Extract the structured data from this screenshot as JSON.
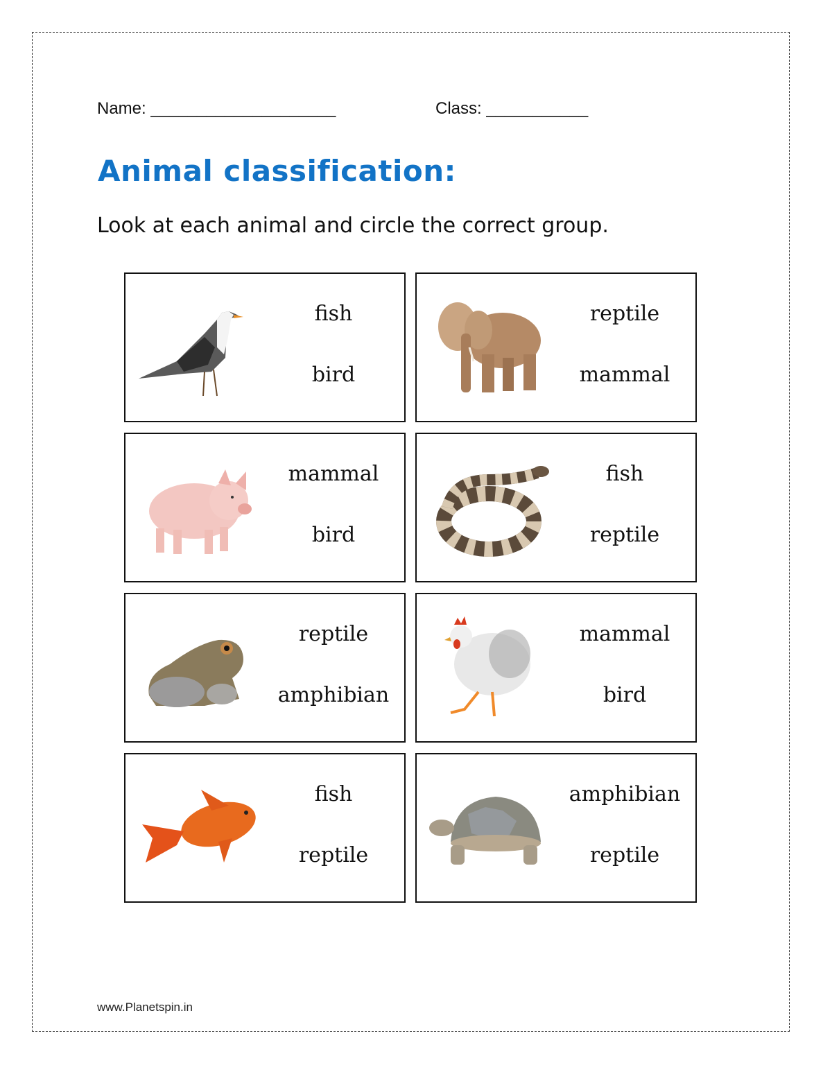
{
  "header": {
    "name_label": "Name: ____________________",
    "class_label": "Class: ___________"
  },
  "title": "Animal classification:",
  "instruction": "Look at each animal and circle the correct group.",
  "title_color": "#1273c6",
  "cards": [
    {
      "animal": "seagull",
      "options": [
        "fish",
        "bird"
      ]
    },
    {
      "animal": "elephant",
      "options": [
        "reptile",
        "mammal"
      ]
    },
    {
      "animal": "pig",
      "options": [
        "mammal",
        "bird"
      ]
    },
    {
      "animal": "snake",
      "options": [
        "fish",
        "reptile"
      ]
    },
    {
      "animal": "toad",
      "options": [
        "reptile",
        "amphibian"
      ]
    },
    {
      "animal": "hen",
      "options": [
        "mammal",
        "bird"
      ]
    },
    {
      "animal": "goldfish",
      "options": [
        "fish",
        "reptile"
      ]
    },
    {
      "animal": "tortoise",
      "options": [
        "amphibian",
        "reptile"
      ]
    }
  ],
  "footer": "www.Planetspin.in"
}
